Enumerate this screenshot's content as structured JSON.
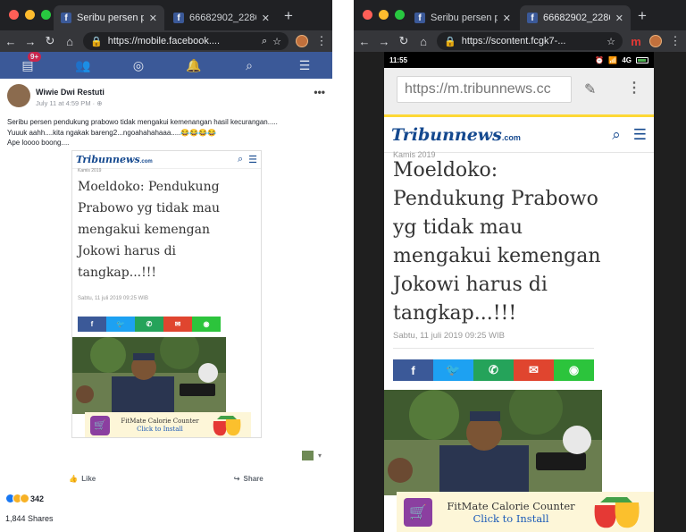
{
  "colors": {
    "facebook_blue": "#3b5998",
    "tribun_blue": "#15498f",
    "share_facebook": "#3b5998",
    "share_twitter": "#1da1f2",
    "share_whatsapp": "#25a35a",
    "share_email": "#e0452f",
    "share_line": "#2cc43c"
  },
  "left_window": {
    "tabs": [
      {
        "title": "Seribu persen pen",
        "favicon": "facebook-icon"
      },
      {
        "title": "66682902_22863",
        "favicon": "facebook-icon"
      }
    ],
    "url": "https://mobile.facebook....",
    "notification_badge": "9+",
    "post": {
      "author": "Wiwie Dwi Restuti",
      "meta": "July 11 at 4:59 PM · ",
      "text_lines": [
        "Seribu persen pendukung prabowo tidak mengakui kemenangan hasil kecurangan.....",
        "Yuuuk aahh....kita ngakak bareng2...ngoahahahaaa.....😂😂😂😂",
        "Ape loooo boong...."
      ],
      "screenshot": {
        "logo_main": "Tribunnews",
        "logo_domain": ".com",
        "date_cut": "Kamis 2019",
        "title": "Moeldoko: Pendukung Prabowo yg tidak mau mengakui kemengan Jokowi harus di tangkap...!!!",
        "timestamp": "Sabtu, 11 juli 2019 09:25 WIB",
        "ad": {
          "title": "FitMate Calorie Counter",
          "link": "Click to Install"
        }
      },
      "actions": {
        "like": "Like",
        "share": "Share"
      },
      "reaction_count": "342",
      "shares_count": "1,844 Shares"
    }
  },
  "right_window": {
    "tabs": [
      {
        "title": "Seribu persen pen",
        "favicon": "facebook-icon"
      },
      {
        "title": "66682902_22863",
        "favicon": "facebook-icon"
      }
    ],
    "url": "https://scontent.fcgk7-...",
    "phone": {
      "time": "11:55",
      "network": "4G",
      "mobile_url": "https://m.tribunnews.cc",
      "logo_main": "Tribunnews",
      "logo_domain": ".com",
      "date_cut": "Kamis 2019",
      "title": "Moeldoko: Pendukung Prabowo yg tidak mau mengakui kemengan Jokowi harus di tangkap...!!!",
      "timestamp": "Sabtu, 11 juli 2019 09:25 WIB",
      "ad": {
        "title": "FitMate Calorie Counter",
        "link": "Click to Install"
      }
    }
  }
}
